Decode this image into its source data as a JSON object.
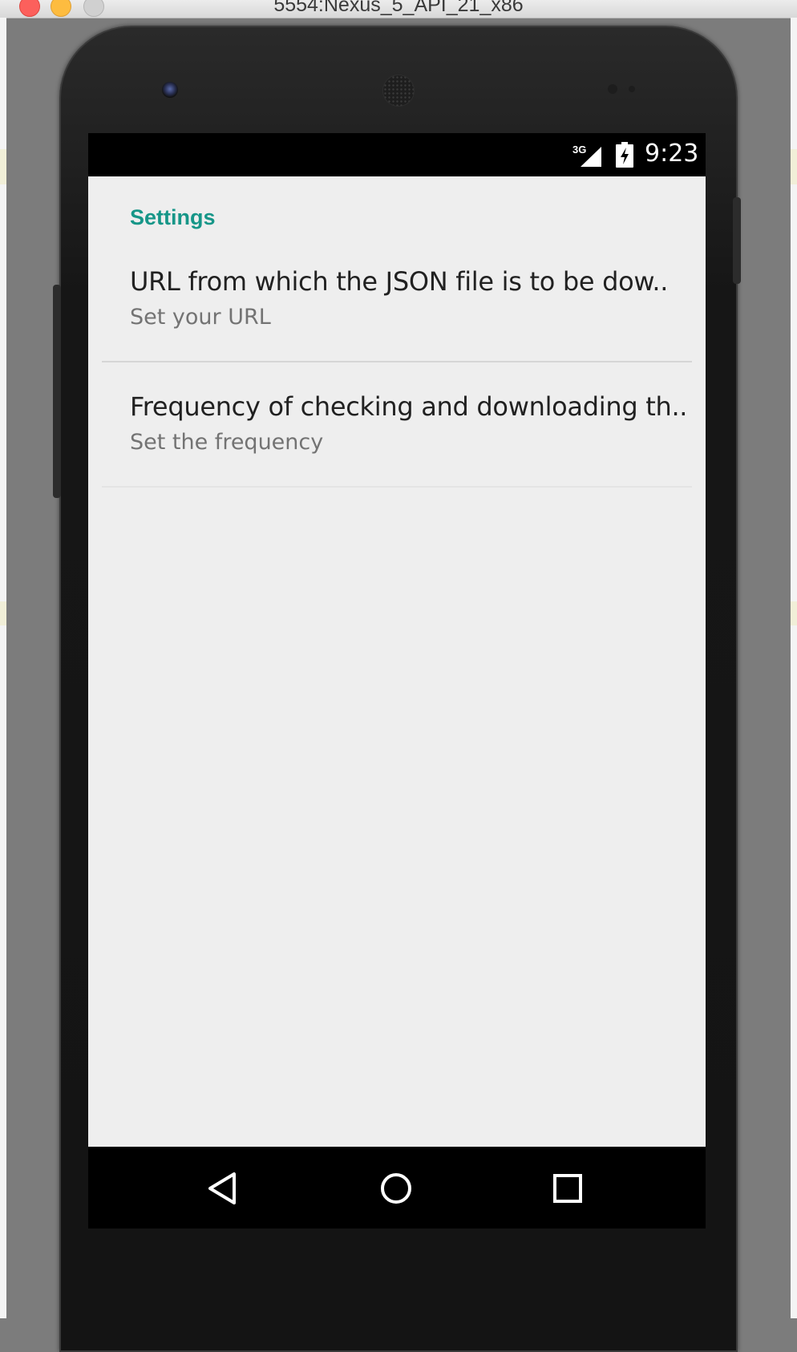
{
  "window": {
    "title": "5554:Nexus_5_API_21_x86"
  },
  "status_bar": {
    "network": "3G",
    "time": "9:23"
  },
  "settings": {
    "category_title": "Settings",
    "items": [
      {
        "title": "URL from which the JSON file is to be dow..",
        "summary": "Set your URL"
      },
      {
        "title": "Frequency of checking and downloading th..",
        "summary": "Set the frequency"
      }
    ]
  },
  "nav": {
    "back_icon": "back-triangle-icon",
    "home_icon": "home-circle-icon",
    "recents_icon": "recents-square-icon"
  },
  "colors": {
    "accent": "#169688",
    "screen_background": "#eeeeee",
    "bars": "#000000"
  }
}
